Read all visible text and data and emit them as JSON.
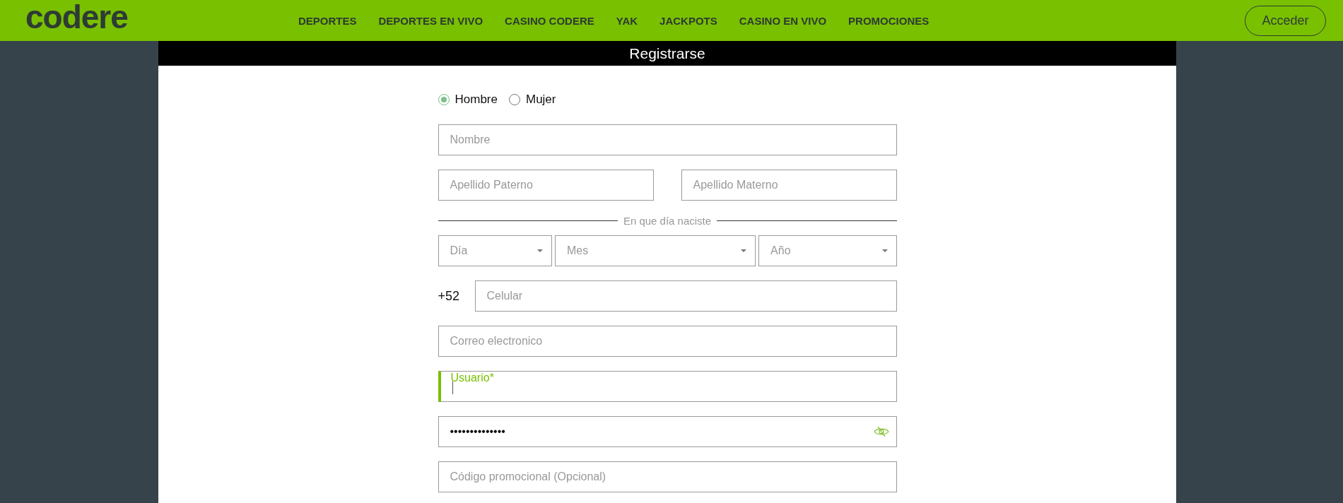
{
  "header": {
    "logo": "codere",
    "nav": [
      {
        "label": "DEPORTES"
      },
      {
        "label": "DEPORTES EN VIVO"
      },
      {
        "label": "CASINO CODERE"
      },
      {
        "label": "YAK"
      },
      {
        "label": "JACKPOTS"
      },
      {
        "label": "CASINO EN VIVO"
      },
      {
        "label": "PROMOCIONES"
      }
    ],
    "login_button": "Acceder"
  },
  "form": {
    "title": "Registrarse",
    "gender": [
      {
        "label": "Hombre",
        "selected": true
      },
      {
        "label": "Mujer",
        "selected": false
      }
    ],
    "name": {
      "placeholder": "Nombre"
    },
    "surnames": [
      {
        "placeholder": "Apellido Paterno"
      },
      {
        "placeholder": "Apellido Materno"
      }
    ],
    "birth_label": "En que día naciste",
    "birth_selects": [
      {
        "placeholder": "Día"
      },
      {
        "placeholder": "Mes"
      },
      {
        "placeholder": "Año"
      }
    ],
    "phone": {
      "prefix": "+52",
      "placeholder": "Celular"
    },
    "email": {
      "placeholder": "Correo electronico"
    },
    "username": {
      "label": "Usuario*",
      "focused": true
    },
    "password": {
      "value": "••••••••••••••"
    },
    "promo": {
      "placeholder": "Código promocional (Opcional)"
    }
  }
}
